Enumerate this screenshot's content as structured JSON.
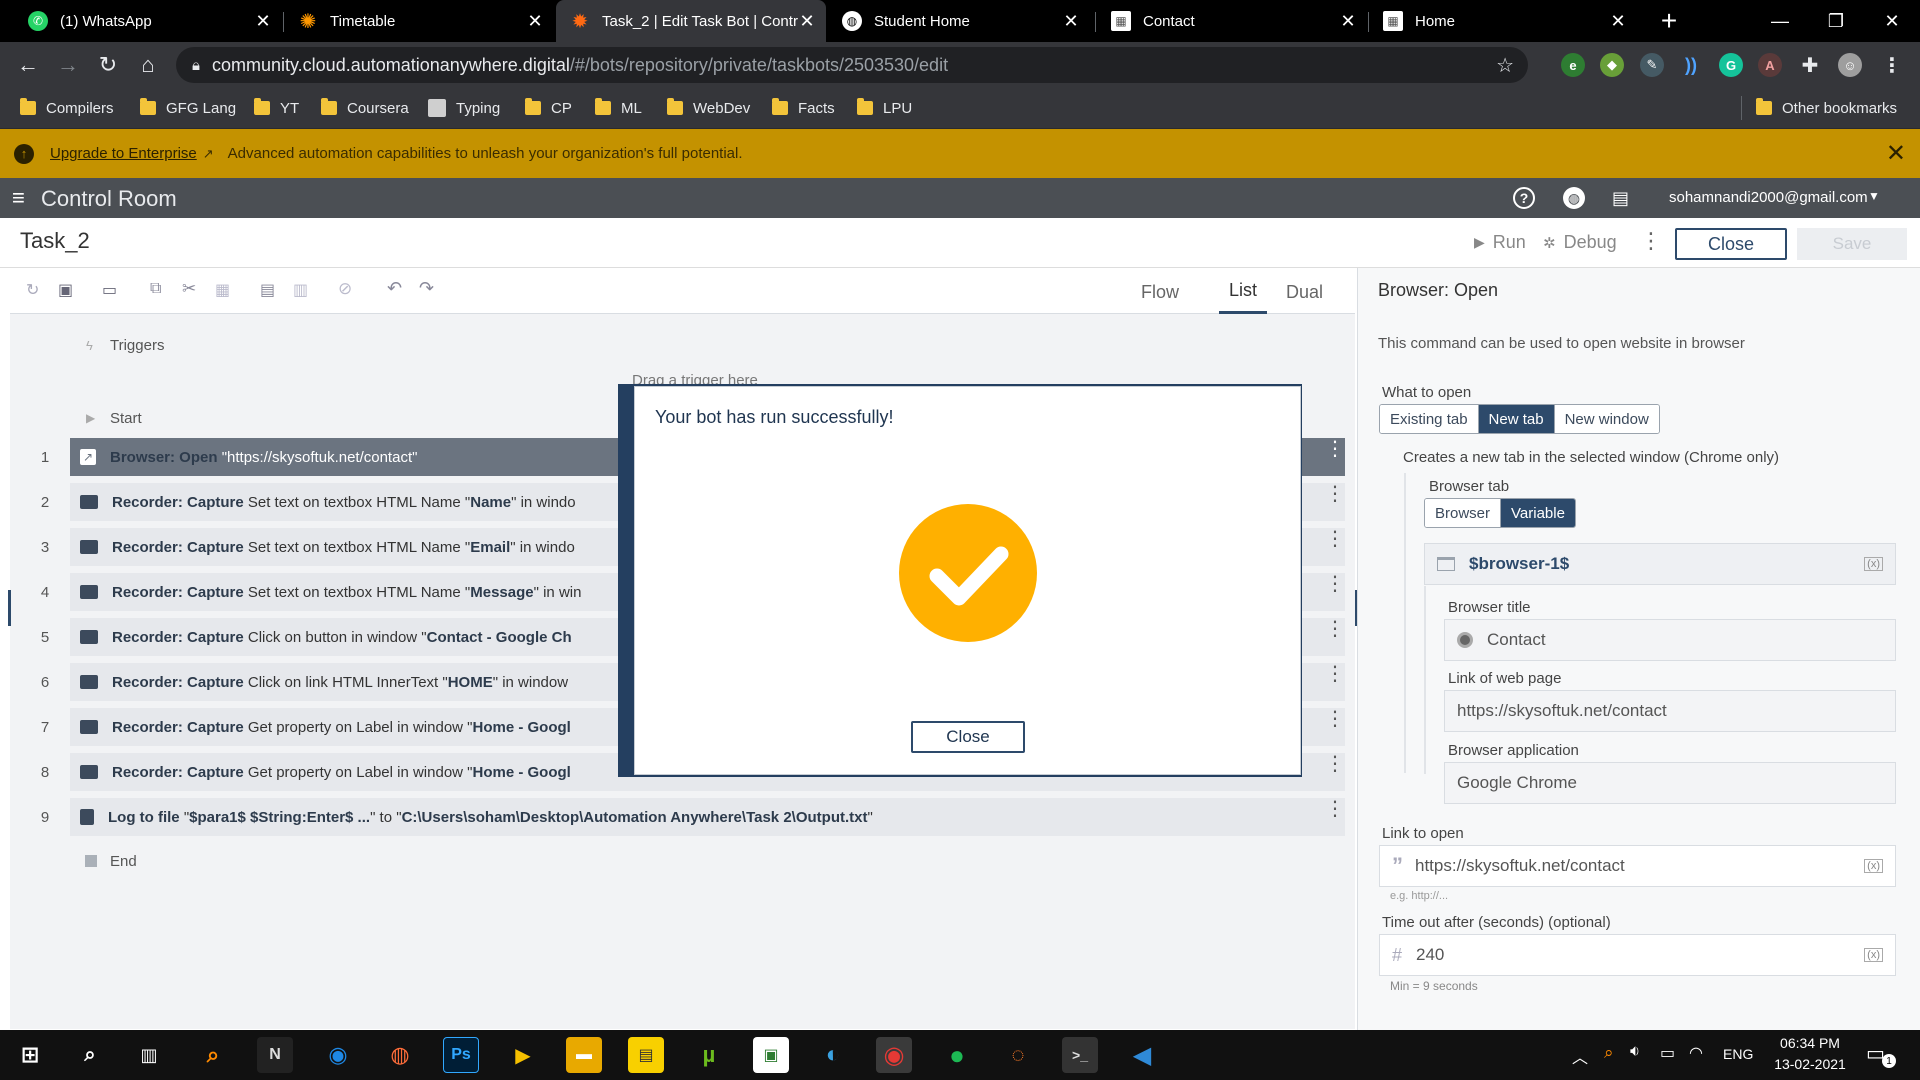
{
  "browser": {
    "tabs": [
      {
        "title": "(1) WhatsApp",
        "icon": "whatsapp-icon",
        "color": "#25d366"
      },
      {
        "title": "Timetable",
        "icon": "sun-icon",
        "color": "#ff9800"
      },
      {
        "title": "Task_2 | Edit Task Bot | Contr",
        "icon": "automation-anywhere-icon",
        "color": "#ff6a13",
        "active": true
      },
      {
        "title": "Student Home",
        "icon": "globe-icon",
        "color": "#ffffff"
      },
      {
        "title": "Contact",
        "icon": "page-icon",
        "color": "#ffffff"
      },
      {
        "title": "Home",
        "icon": "page-icon",
        "color": "#ffffff"
      }
    ],
    "url_host": "community.cloud.automationanywhere.digital",
    "url_path": "/#/bots/repository/private/taskbots/2503530/edit",
    "bookmarks": [
      "Compilers",
      "GFG Lang",
      "YT",
      "Coursera",
      "Typing",
      "CP",
      "ML",
      "WebDev",
      "Facts",
      "LPU"
    ],
    "other_bookmarks": "Other bookmarks"
  },
  "banner": {
    "link": "Upgrade to Enterprise",
    "text": "Advanced automation capabilities to unleash your organization's full potential."
  },
  "header": {
    "app_title": "Control Room",
    "user": "sohamnandi2000@gmail.com"
  },
  "task": {
    "name": "Task_2",
    "run": "Run",
    "debug": "Debug",
    "close": "Close",
    "save": "Save"
  },
  "views": {
    "flow": "Flow",
    "list": "List",
    "dual": "Dual"
  },
  "editor": {
    "triggers": "Triggers",
    "drag_hint": "Drag a trigger here",
    "start": "Start",
    "end": "End",
    "rows": [
      {
        "num": "1",
        "html": "<b>Browser: Open</b> \"https://skysoftuk.net/contact\"",
        "selected": true
      },
      {
        "num": "2",
        "html": "<b>Recorder: Capture</b> Set text on textbox HTML Name \"<b>Name</b>\" in windo"
      },
      {
        "num": "3",
        "html": "<b>Recorder: Capture</b> Set text on textbox HTML Name \"<b>Email</b>\" in windo"
      },
      {
        "num": "4",
        "html": "<b>Recorder: Capture</b> Set text on textbox HTML Name \"<b>Message</b>\" in win"
      },
      {
        "num": "5",
        "html": "<b>Recorder: Capture</b> Click on button in window \"<b>Contact - Google Ch</b>"
      },
      {
        "num": "6",
        "html": "<b>Recorder: Capture</b> Click on link HTML InnerText \"<b>HOME</b>\" in window"
      },
      {
        "num": "7",
        "html": "<b>Recorder: Capture</b> Get property on Label in window \"<b>Home - Googl</b>"
      },
      {
        "num": "8",
        "html": "<b>Recorder: Capture</b> Get property on Label in window \"<b>Home - Googl</b>"
      },
      {
        "num": "9",
        "html": "<b>Log to file</b> \"<b>$para1$ $String:Enter$ ...</b>\" to \"<b>C:\\Users\\soham\\Desktop\\Automation Anywhere\\Task 2\\Output.txt</b>\""
      }
    ]
  },
  "panel": {
    "title": "Browser: Open",
    "description": "This command can be used to open website in browser",
    "what_to_open": "What to open",
    "open_options": [
      "Existing tab",
      "New tab",
      "New window"
    ],
    "new_tab_note": "Creates a new tab in the selected window (Chrome only)",
    "browser_tab": "Browser tab",
    "tab_options": [
      "Browser",
      "Variable"
    ],
    "variable_value": "$browser-1$",
    "browser_title_label": "Browser title",
    "browser_title": "Contact",
    "link_label": "Link of web page",
    "link_value": "https://skysoftuk.net/contact",
    "app_label": "Browser application",
    "app_value": "Google Chrome",
    "link_to_open_label": "Link to open",
    "link_to_open": "https://skysoftuk.net/contact",
    "link_hint": "e.g. http://...",
    "timeout_label": "Time out after (seconds) (optional)",
    "timeout": "240",
    "timeout_hint": "Min = 9 seconds"
  },
  "modal": {
    "title": "Your bot has run successfully!",
    "close": "Close",
    "check_color": "#ffb000"
  },
  "taskbar": {
    "lang": "ENG",
    "time": "06:34 PM",
    "date": "13-02-2021",
    "notifications": "1"
  },
  "colors": {
    "banner": "#c49200",
    "header": "#4b4f54",
    "selected_row": "#6b7480",
    "accent": "#2d4a6b"
  }
}
